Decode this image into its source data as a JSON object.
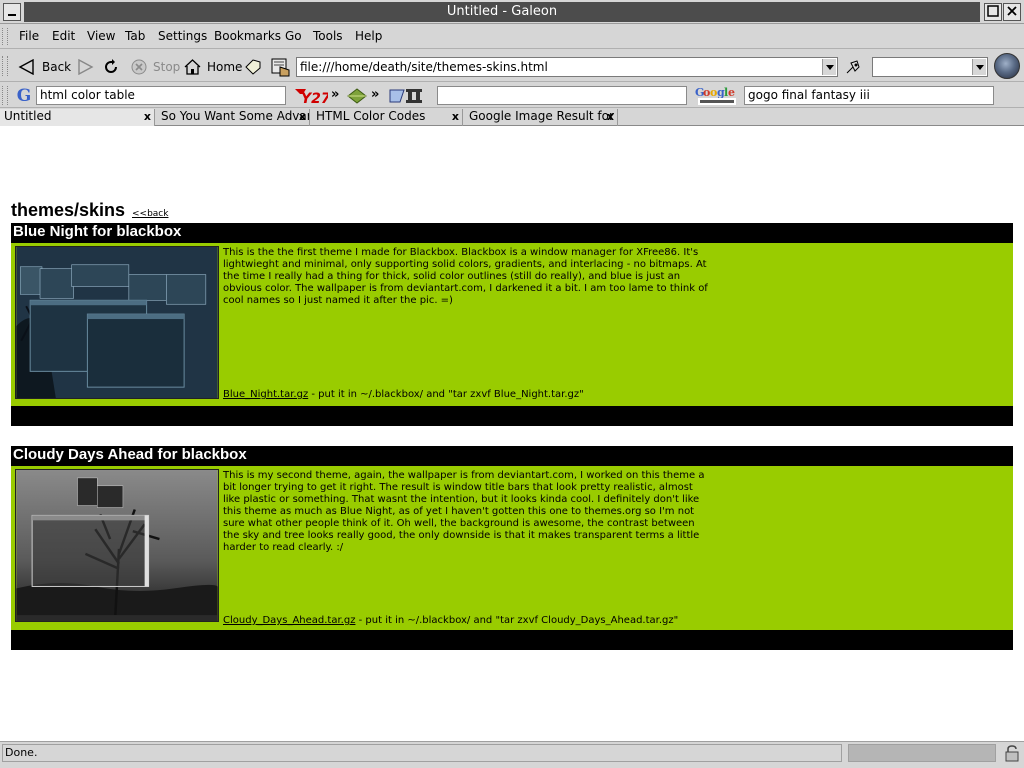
{
  "window": {
    "title": "Untitled - Galeon",
    "controls": [
      "minimize",
      "maximize",
      "close"
    ]
  },
  "menubar": {
    "items": [
      "File",
      "Edit",
      "View",
      "Tab",
      "Settings",
      "Bookmarks",
      "Go",
      "Tools",
      "Help"
    ]
  },
  "toolbar": {
    "back_label": "Back",
    "stop_label": "Stop",
    "home_label": "Home",
    "url": "file:///home/death/site/themes-skins.html",
    "search_select_value": ""
  },
  "searchbar": {
    "google_query": "html color table",
    "middle_field": "",
    "images_query": "gogo final fantasy iii",
    "arrows": "»"
  },
  "tabs": [
    {
      "label": "Untitled",
      "active": true
    },
    {
      "label": "So You Want Some Advan",
      "active": false
    },
    {
      "label": "HTML Color Codes",
      "active": false
    },
    {
      "label": "Google Image Result for v",
      "active": false
    }
  ],
  "page": {
    "heading": "themes/skins",
    "back_link": "<<back",
    "themes": [
      {
        "title": "Blue Night for blackbox",
        "description": "This is the the first theme I made for Blackbox. Blackbox is a window manager for XFree86. It's lightwieght and minimal, only supporting solid colors, gradients, and interlacing - no bitmaps. At the time I really had a thing for thick, solid color outlines (still do really), and blue is just an obvious color. The wallpaper is from deviantart.com, I darkened it a bit. I am too lame to think of cool names so I just named it after the pic. =)",
        "download_link": "Blue_Night.tar.gz",
        "download_note": " - put it in ~/.blackbox/ and \"tar zxvf Blue_Night.tar.gz\""
      },
      {
        "title": "Cloudy Days Ahead for blackbox",
        "description": "This is my second theme, again, the wallpaper is from deviantart.com, I worked on this theme a bit longer trying to get it right. The result is window title bars that look pretty realistic, almost like plastic or something. That wasnt the intention, but it looks kinda cool. I definitely don't like this theme as much as Blue Night, as of yet I haven't gotten this one to themes.org so I'm not sure what other people think of it. Oh well, the background is awesome, the contrast between the sky and tree looks really good, the only downside is that it makes transparent terms a little harder to read clearly. :/",
        "download_link": "Cloudy_Days_Ahead.tar.gz",
        "download_note": " - put it in ~/.blackbox/ and \"tar zxvf Cloudy_Days_Ahead.tar.gz\""
      }
    ]
  },
  "status": {
    "text": "Done."
  },
  "colors": {
    "section_bg": "#000000",
    "section_body_bg": "#99cc00",
    "title_bar_bg": "#4c4c4c"
  }
}
